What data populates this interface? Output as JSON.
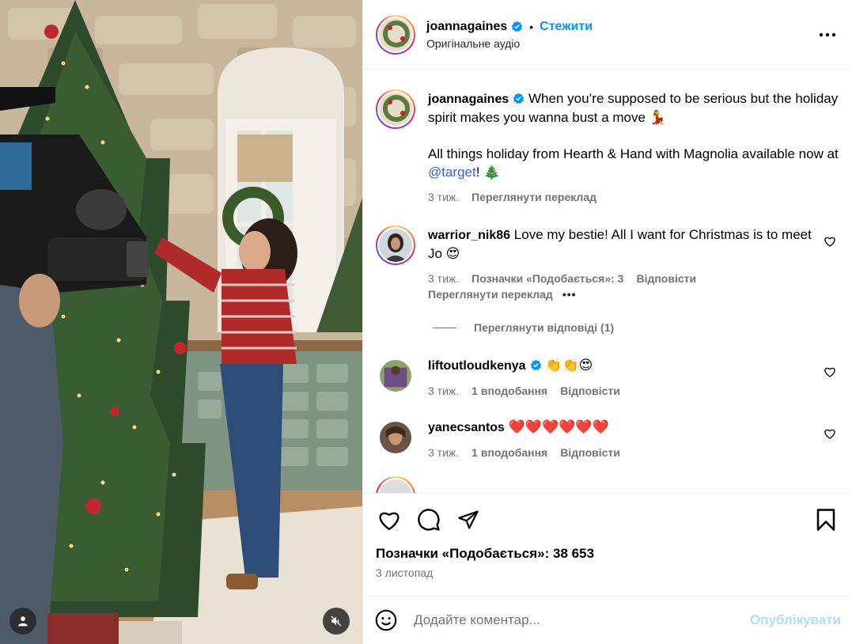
{
  "colors": {
    "accent": "#0095f6",
    "muted": "#737373",
    "border": "#efefef",
    "publish_disabled": "#b3dbff"
  },
  "media": {
    "user_tag_icon": "person-icon",
    "mute_icon": "speaker-muted-icon"
  },
  "header": {
    "username": "joannagaines",
    "separator": "•",
    "follow_label": "Стежити",
    "audio_label": "Оригінальне аудіо",
    "more_icon": "more-options-icon"
  },
  "caption": {
    "username": "joannagaines",
    "text_line1": "When you’re supposed to be serious but the holiday spirit makes you wanna bust a move 💃",
    "text_line2_before": "All things holiday from Hearth & Hand with Magnolia available now at ",
    "mention": "@target",
    "text_line2_after": "! 🎄",
    "time": "3 тиж.",
    "translate": "Переглянути переклад"
  },
  "comments": [
    {
      "username": "warrior_nik86",
      "text": "Love my bestie! All I want for Christmas is to meet Jo 😍",
      "time": "3 тиж.",
      "likes": "Позначки «Подобається»: 3",
      "reply": "Відповісти",
      "translate": "Переглянути переклад",
      "more": "•••",
      "view_replies": "Переглянути відповіді (1)"
    },
    {
      "username": "liftoutloudkenya",
      "text": "👏👏😍",
      "time": "3 тиж.",
      "likes": "1 вподобання",
      "reply": "Відповісти"
    },
    {
      "username": "yanecsantos",
      "text": "❤️❤️❤️❤️❤️❤️",
      "time": "3 тиж.",
      "likes": "1 вподобання",
      "reply": "Відповісти"
    }
  ],
  "actions": {
    "like_icon": "heart-icon",
    "comment_icon": "comment-icon",
    "share_icon": "send-icon",
    "save_icon": "bookmark-icon",
    "likes_count": "Позначки «Подобається»: 38 653",
    "date": "3 листопад"
  },
  "compose": {
    "emoji_icon": "emoji-icon",
    "placeholder": "Додайте коментар...",
    "publish_label": "Опублікувати"
  }
}
